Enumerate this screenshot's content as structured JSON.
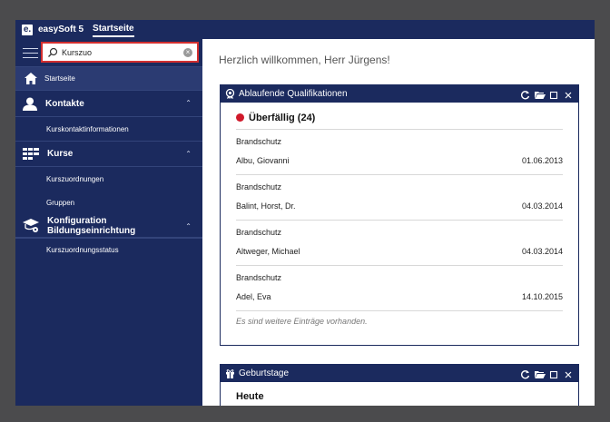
{
  "app": {
    "logo_letter": "e.",
    "name": "easySoft 5",
    "tab": "Startseite"
  },
  "search": {
    "value": "Kurszuo",
    "clear_symbol": "×"
  },
  "sidebar": {
    "home": {
      "label": "Startseite",
      "icon": "home-icon"
    },
    "sections": [
      {
        "label": "Kontakte",
        "icon": "contacts-icon",
        "chevron": "⌃",
        "items": [
          "Kurskontaktinformationen"
        ]
      },
      {
        "label": "Kurse",
        "icon": "courses-grid-icon",
        "chevron": "⌃",
        "items": [
          "Kurszuordnungen",
          "Gruppen"
        ]
      },
      {
        "label_line1": "Konfiguration",
        "label_line2": "Bildungseinrichtung",
        "icon": "config-gear-icon",
        "chevron": "⌃",
        "items": [
          "Kurszuordnungsstatus"
        ]
      }
    ]
  },
  "main": {
    "welcome": "Herzlich willkommen, Herr Jürgens!",
    "qualifications": {
      "title": "Ablaufende Qualifikationen",
      "status_label": "Überfällig (24)",
      "status_color": "#d0192a",
      "entries": [
        {
          "course": "Brandschutz",
          "person": "Albu, Giovanni",
          "date": "01.06.2013"
        },
        {
          "course": "Brandschutz",
          "person": "Balint, Horst, Dr.",
          "date": "04.03.2014"
        },
        {
          "course": "Brandschutz",
          "person": "Altweger, Michael",
          "date": "04.03.2014"
        },
        {
          "course": "Brandschutz",
          "person": "Adel, Eva",
          "date": "14.10.2015"
        }
      ],
      "more_note": "Es sind weitere Einträge vorhanden."
    },
    "birthdays": {
      "title": "Geburtstage",
      "section_label": "Heute"
    }
  },
  "colors": {
    "navy": "#1b2a5e",
    "accent_red": "#d32f2f",
    "backdrop": "#4b4b4d"
  }
}
